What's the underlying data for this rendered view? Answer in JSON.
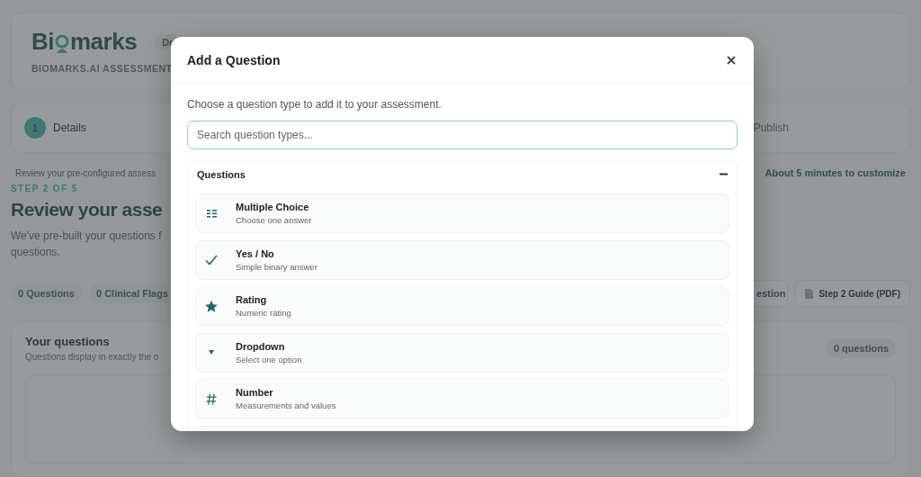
{
  "header": {
    "logo_start": "Bi",
    "logo_end": "marks",
    "badge": "Dr",
    "subtitle": "BIOMARKS.AI ASSESSMENT"
  },
  "stepper": {
    "first_step": {
      "number": "1",
      "label": "Details",
      "selected": true
    },
    "last_step": {
      "label": "Publish",
      "selected": false
    }
  },
  "intro": {
    "note": "Review your pre-configured assess",
    "time_estimate": "About 5 minutes to customize",
    "step_label": "STEP 2 OF 5",
    "heading": "Review your asse",
    "description_lines": [
      "We've pre-built your questions f",
      "questions."
    ]
  },
  "toolbar": {
    "pills": [
      "0 Questions",
      "0 Clinical Flags"
    ],
    "add_button": "estion",
    "guide_button": "Step 2 Guide (PDF)"
  },
  "questions_card": {
    "title": "Your questions",
    "subtitle": "Questions display in exactly the o",
    "count": "0 questions"
  },
  "dialog": {
    "title": "Add a Question",
    "description": "Choose a question type to add it to your assessment.",
    "search": {
      "placeholder": "Search question types..."
    },
    "section": {
      "title": "Questions",
      "expanded": true,
      "items": [
        {
          "kind": "multiple_choice",
          "title": "Multiple Choice",
          "subtitle": "Choose one answer"
        },
        {
          "kind": "yes_no",
          "title": "Yes / No",
          "subtitle": "Simple binary answer"
        },
        {
          "kind": "rating",
          "title": "Rating",
          "subtitle": "Numeric rating"
        },
        {
          "kind": "dropdown",
          "title": "Dropdown",
          "subtitle": "Select one option"
        },
        {
          "kind": "number",
          "title": "Number",
          "subtitle": "Measurements and values"
        }
      ]
    }
  }
}
